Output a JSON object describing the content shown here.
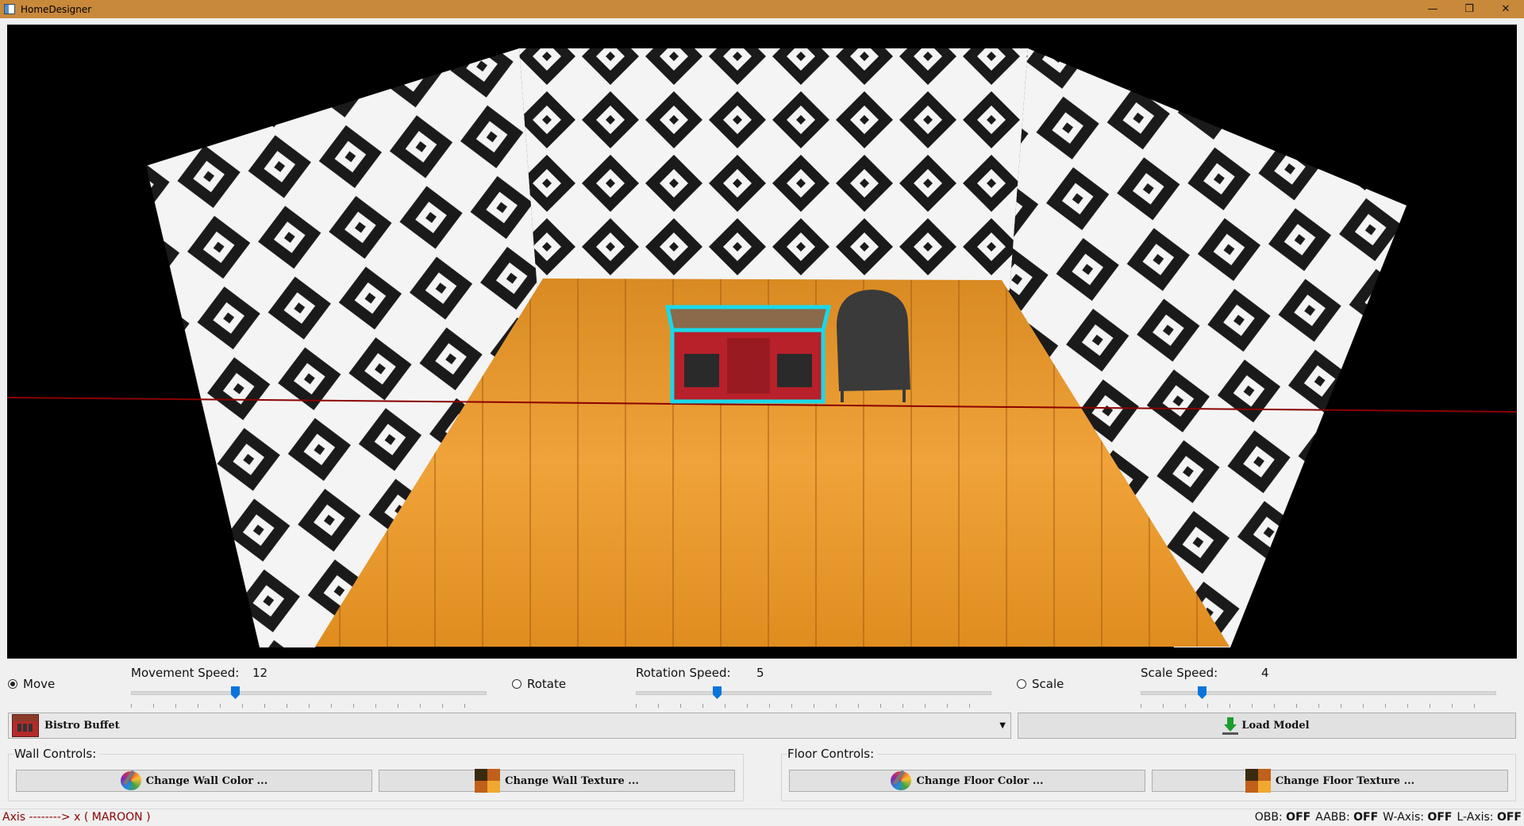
{
  "window": {
    "title": "HomeDesigner",
    "controls": [
      "—",
      "❐",
      "✕"
    ]
  },
  "transform_modes": [
    {
      "label": "Move",
      "selected": true
    },
    {
      "label": "Rotate",
      "selected": false
    },
    {
      "label": "Scale",
      "selected": false
    }
  ],
  "speeds": {
    "movement": {
      "label": "Movement Speed:",
      "value": "12"
    },
    "rotation": {
      "label": "Rotation Speed:",
      "value": "5"
    },
    "scale": {
      "label": "Scale Speed:",
      "value": "4"
    }
  },
  "model_select": {
    "selected": "Bistro Buffet"
  },
  "load_model_button": "Load Model",
  "wall_controls": {
    "label": "Wall Controls:",
    "color_button": "Change Wall Color ...",
    "texture_button": "Change Wall Texture ..."
  },
  "floor_controls": {
    "label": "Floor Controls:",
    "color_button": "Change Floor Color ...",
    "texture_button": "Change Floor Texture ..."
  },
  "status": {
    "axis_text": "Axis --------> x ( MAROON )",
    "toggles": [
      {
        "name": "OBB:",
        "value": "OFF"
      },
      {
        "name": "AABB:",
        "value": "OFF"
      },
      {
        "name": "W-Axis:",
        "value": "OFF"
      },
      {
        "name": "L-Axis:",
        "value": "OFF"
      }
    ]
  },
  "colors": {
    "title_bar": "#c8893a",
    "selection_outline": "#19d8e8",
    "axis_line": "#8b0000",
    "slider_thumb": "#0a74da"
  },
  "icons": [
    "window-icon",
    "minimize-icon",
    "restore-icon",
    "close-icon",
    "download-icon",
    "color-wheel-icon",
    "texture-icon",
    "model-thumbnail-icon",
    "dropdown-arrow-icon"
  ]
}
